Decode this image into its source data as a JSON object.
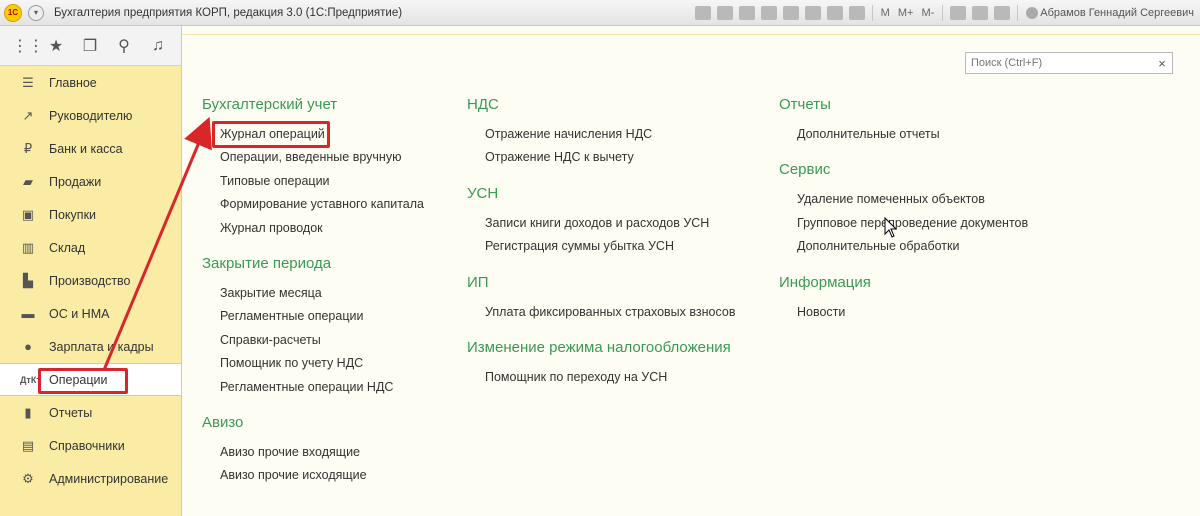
{
  "titlebar": {
    "app_title": "Бухгалтерия предприятия КОРП, редакция 3.0  (1С:Предприятие)",
    "m_label": "M",
    "mplus_label": "M+",
    "mminus_label": "M-",
    "user": "Абрамов Геннадий Сергеевич"
  },
  "sidebar": {
    "items": [
      {
        "label": "Главное",
        "icon": "menu-lines-icon"
      },
      {
        "label": "Руководителю",
        "icon": "trend-icon"
      },
      {
        "label": "Банк и касса",
        "icon": "ruble-icon"
      },
      {
        "label": "Продажи",
        "icon": "bag-icon"
      },
      {
        "label": "Покупки",
        "icon": "cart-icon"
      },
      {
        "label": "Склад",
        "icon": "warehouse-icon"
      },
      {
        "label": "Производство",
        "icon": "factory-icon"
      },
      {
        "label": "ОС и НМА",
        "icon": "car-icon"
      },
      {
        "label": "Зарплата и кадры",
        "icon": "people-icon"
      },
      {
        "label": "Операции",
        "icon": "dt-kt-icon"
      },
      {
        "label": "Отчеты",
        "icon": "bar-chart-icon"
      },
      {
        "label": "Справочники",
        "icon": "book-icon"
      },
      {
        "label": "Администрирование",
        "icon": "gear-icon"
      }
    ]
  },
  "search": {
    "placeholder": "Поиск (Ctrl+F)"
  },
  "columns": [
    [
      {
        "title": "Бухгалтерский учет",
        "links": [
          "Журнал операций",
          "Операции, введенные вручную",
          "Типовые операции",
          "Формирование уставного капитала",
          "Журнал проводок"
        ]
      },
      {
        "title": "Закрытие периода",
        "links": [
          "Закрытие месяца",
          "Регламентные операции",
          "Справки-расчеты",
          "Помощник по учету НДС",
          "Регламентные операции НДС"
        ]
      },
      {
        "title": "Авизо",
        "links": [
          "Авизо прочие входящие",
          "Авизо прочие исходящие"
        ]
      }
    ],
    [
      {
        "title": "НДС",
        "links": [
          "Отражение начисления НДС",
          "Отражение НДС к вычету"
        ]
      },
      {
        "title": "УСН",
        "links": [
          "Записи книги доходов и расходов УСН",
          "Регистрация суммы убытка УСН"
        ]
      },
      {
        "title": "ИП",
        "links": [
          "Уплата фиксированных страховых взносов"
        ]
      },
      {
        "title": "Изменение режима налогообложения",
        "links": [
          "Помощник по переходу на УСН"
        ]
      }
    ],
    [
      {
        "title": "Отчеты",
        "links": [
          "Дополнительные отчеты"
        ]
      },
      {
        "title": "Сервис",
        "links": [
          "Удаление помеченных объектов",
          "Групповое перепроведение документов",
          "Дополнительные обработки"
        ]
      },
      {
        "title": "Информация",
        "links": [
          "Новости"
        ]
      }
    ]
  ],
  "colors": {
    "accent_green": "#3a9a53",
    "sidebar_bg": "#fbeca5",
    "highlight_red": "#d9262a"
  }
}
